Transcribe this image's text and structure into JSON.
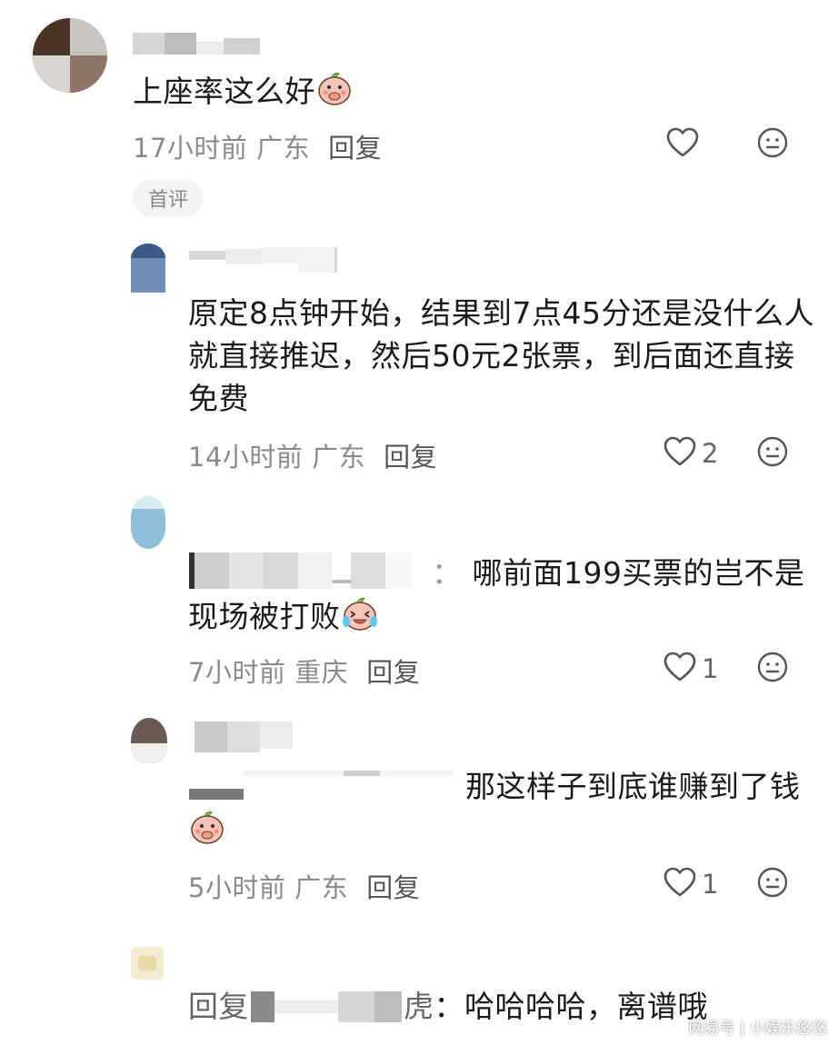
{
  "comments": [
    {
      "text": "上座率这么好",
      "emoji": "peach-covering-mouth-emoji",
      "time": "17小时前",
      "location": "广东",
      "reply_label": "回复",
      "like_count": "",
      "badge": "首评"
    },
    {
      "text": "原定8点钟开始，结果到7点45分还是没什么人就直接推迟，然后50元2张票，到后面还直接免费",
      "time": "14小时前",
      "location": "广东",
      "reply_label": "回复",
      "like_count": "2"
    },
    {
      "sep": "：",
      "text": "哪前面199买票的岂不是现场被打败",
      "emoji": "peach-crying-laughing-emoji",
      "time": "7小时前",
      "location": "重庆",
      "reply_label": "回复",
      "like_count": "1"
    },
    {
      "text": "那这样子到底谁赚到了钱",
      "emoji": "peach-covering-mouth-emoji",
      "time": "5小时前",
      "location": "广东",
      "reply_label": "回复",
      "like_count": "1"
    },
    {
      "reply_prefix_1": "回复",
      "reply_prefix_2": "虎",
      "sep": "：",
      "text": "哈哈哈哈，离谱哦"
    }
  ],
  "watermark": "网易号 | 小娱乐悠悠",
  "icons": {
    "like": "heart-outline-icon",
    "dislike": "neutral-face-icon"
  },
  "colors": {
    "text": "#1a1a1a",
    "meta": "#8a8a8a",
    "icon": "#555555"
  }
}
